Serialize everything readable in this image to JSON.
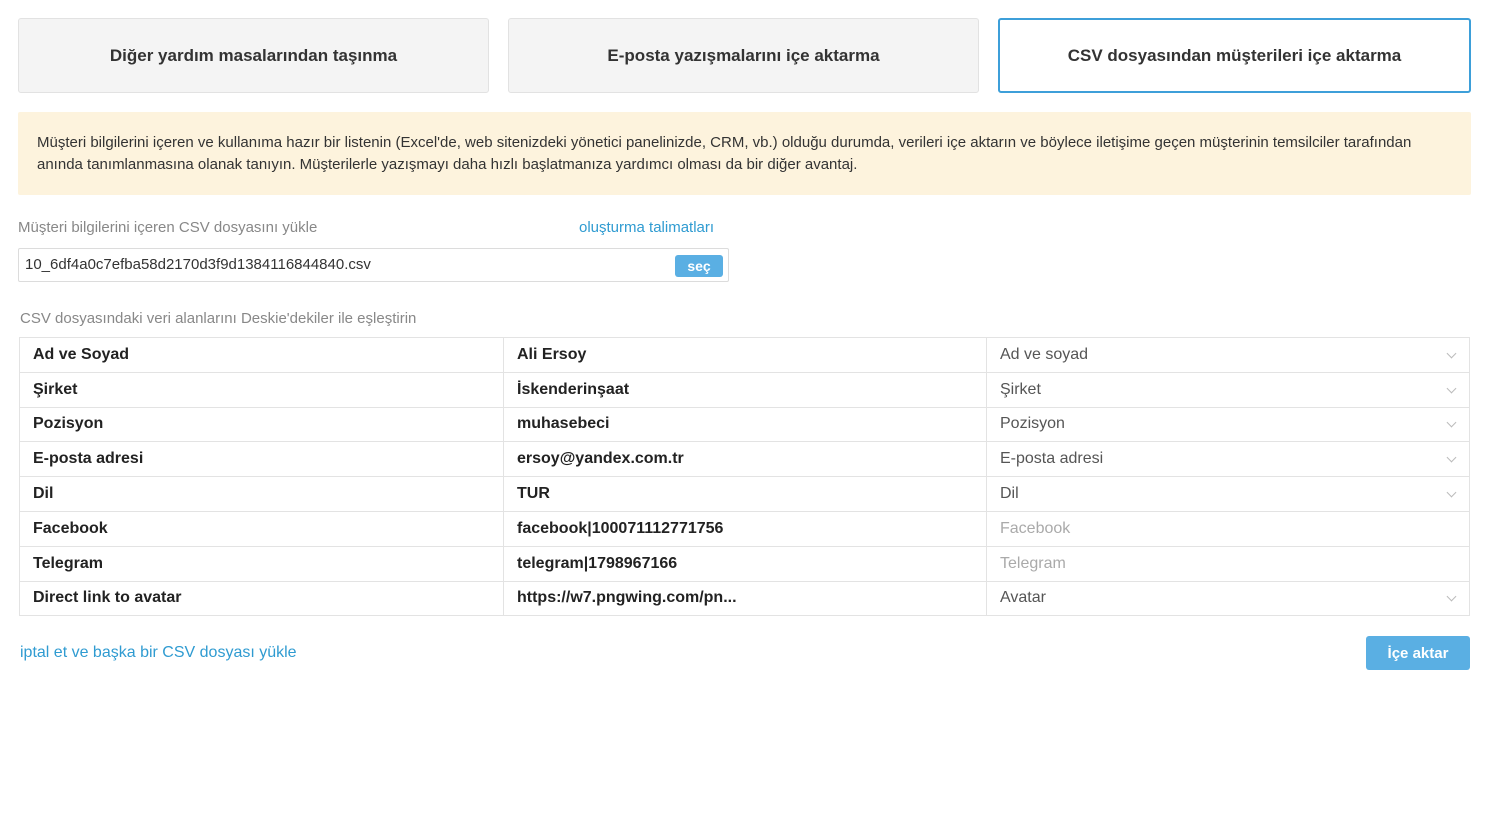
{
  "tabs": [
    {
      "label": "Diğer yardım masalarından taşınma",
      "active": false
    },
    {
      "label": "E-posta yazışmalarını içe aktarma",
      "active": false
    },
    {
      "label": "CSV dosyasından müşterileri içe aktarma",
      "active": true
    }
  ],
  "notice": {
    "text": "Müşteri bilgilerini içeren ve kullanıma hazır bir listenin (Excel'de, web sitenizdeki yönetici panelinizde, CRM, vb.) olduğu durumda, verileri içe aktarın ve böylece iletişime geçen müşterinin temsilciler tarafından anında tanımlanmasına olanak tanıyın. Müşterilerle yazışmayı daha hızlı başlatmanıza yardımcı olması da bir diğer avantaj."
  },
  "upload": {
    "label": "Müşteri bilgilerini içeren CSV dosyasını yükle",
    "instructions_link": "oluşturma talimatları",
    "file_name": "10_6df4a0c7efba58d2170d3f9d1384116844840.csv",
    "choose_button": "seç"
  },
  "mapping": {
    "label": "CSV dosyasındaki veri alanlarını Deskie'dekiler ile eşleştirin",
    "rows": [
      {
        "field": "Ad ve Soyad",
        "sample": "Ali Ersoy",
        "target": "Ad ve soyad",
        "dropdown": true
      },
      {
        "field": "Şirket",
        "sample": "İskenderinşaat",
        "target": "Şirket",
        "dropdown": true
      },
      {
        "field": "Pozisyon",
        "sample": "muhasebeci",
        "target": "Pozisyon",
        "dropdown": true
      },
      {
        "field": "E-posta adresi",
        "sample": "ersoy@yandex.com.tr",
        "target": "E-posta adresi",
        "dropdown": true
      },
      {
        "field": "Dil",
        "sample": "TUR",
        "target": "Dil",
        "dropdown": true
      },
      {
        "field": "Facebook",
        "sample": "facebook|100071112771756",
        "target": "Facebook",
        "dropdown": false
      },
      {
        "field": "Telegram",
        "sample": "telegram|1798967166",
        "target": "Telegram",
        "dropdown": false
      },
      {
        "field": "Direct link to avatar",
        "sample": "https://w7.pngwing.com/pn...",
        "target": "Avatar",
        "dropdown": true
      }
    ]
  },
  "footer": {
    "cancel_link": "iptal et ve başka bir CSV dosyası yükle",
    "import_button": "İçe aktar"
  },
  "colors": {
    "accent": "#3d9fd9",
    "button": "#5aafe3",
    "notice_bg": "#fdf3dd"
  }
}
